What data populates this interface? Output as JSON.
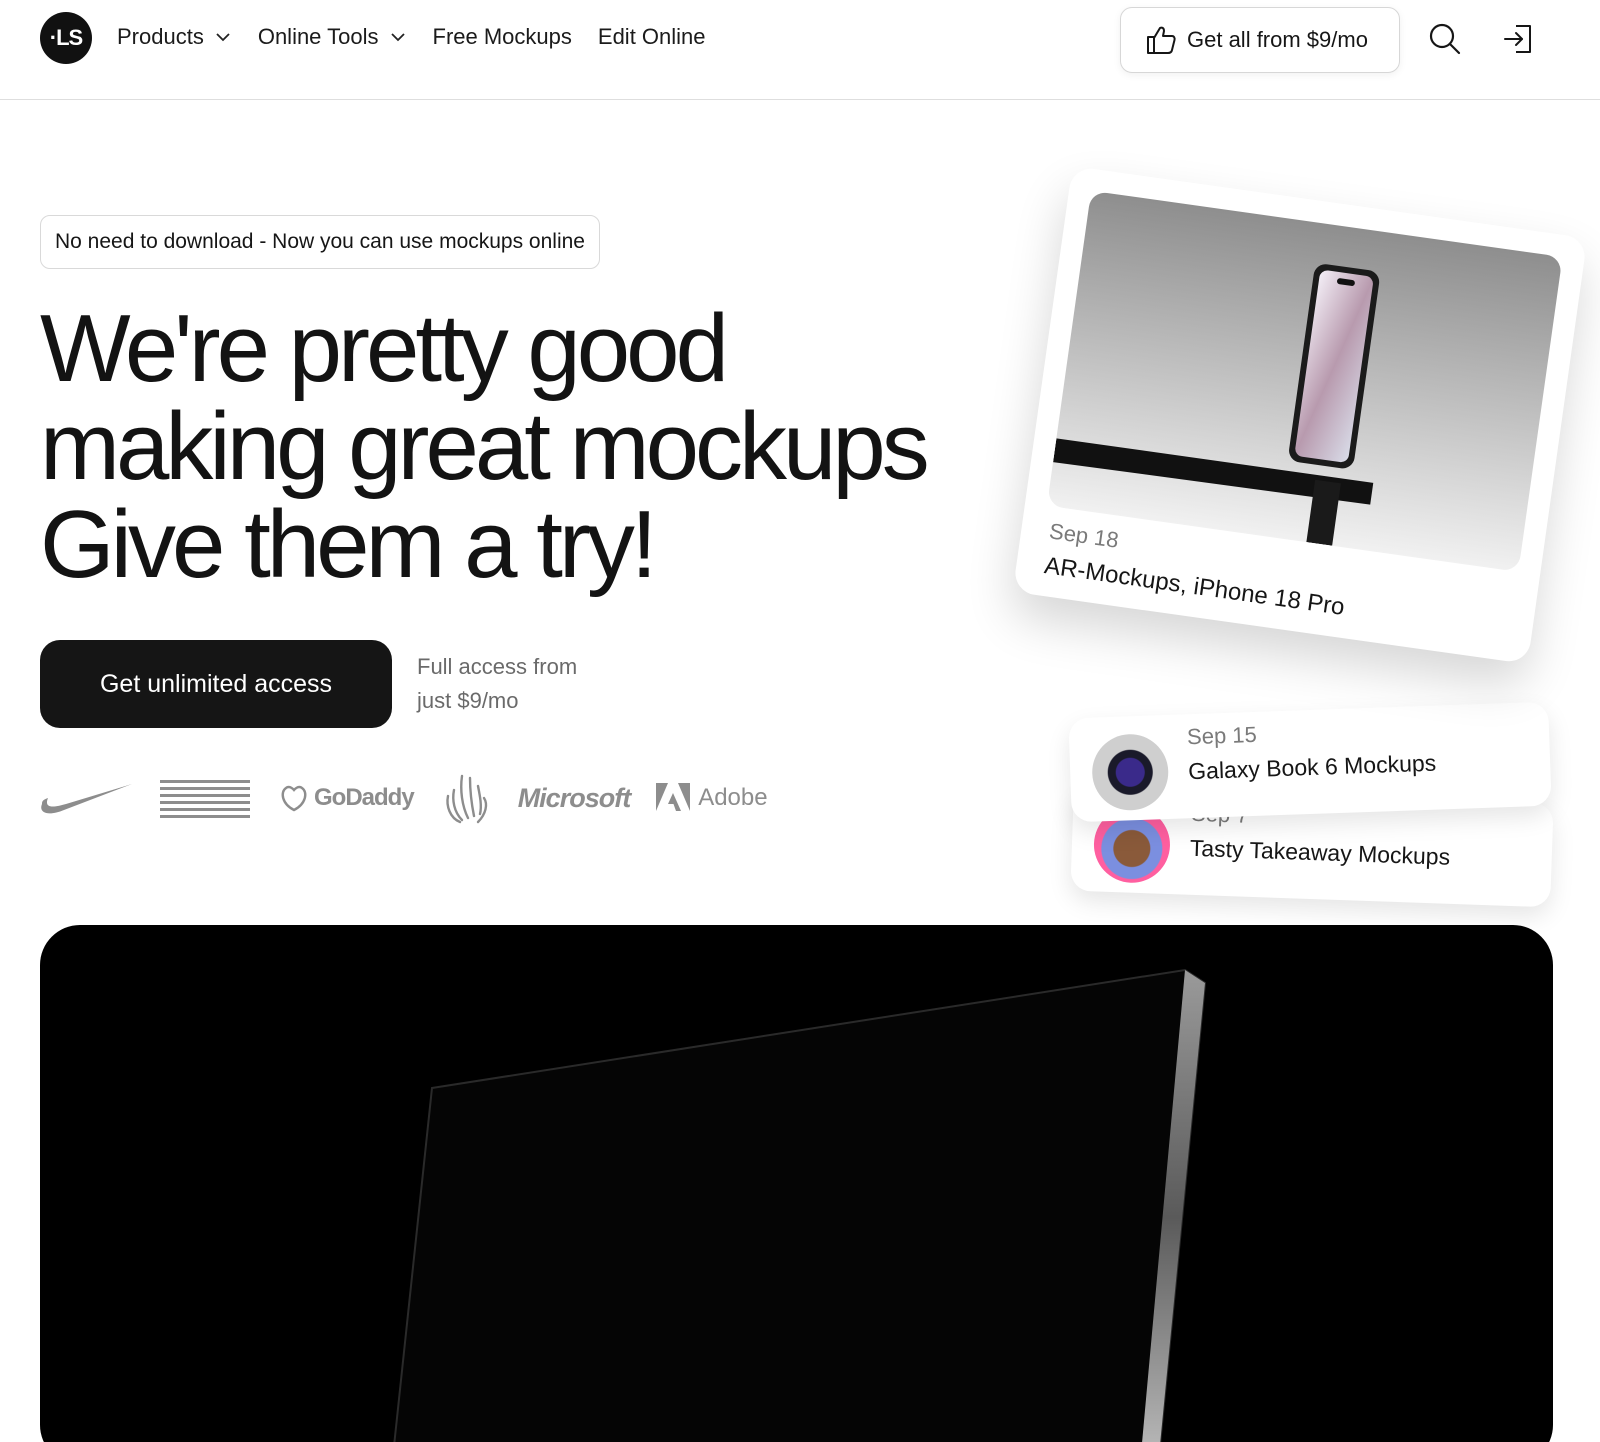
{
  "nav": {
    "logo_text": "·LS",
    "items": [
      {
        "label": "Products",
        "has_dropdown": true
      },
      {
        "label": "Online Tools",
        "has_dropdown": true
      },
      {
        "label": "Free Mockups",
        "has_dropdown": false
      },
      {
        "label": "Edit Online",
        "has_dropdown": false
      }
    ],
    "cta_label": "Get all from $9/mo",
    "search_icon": "search-icon",
    "login_icon": "login-icon"
  },
  "hero": {
    "badge": "No need to download - Now you can use mockups online",
    "headline": [
      "We're pretty good",
      "making great mockups",
      "Give them a try!"
    ],
    "button_label": "Get unlimited access",
    "note_line1": "Full access from",
    "note_line2": "just $9/mo"
  },
  "brands": [
    "nike-logo",
    "IBM",
    "GoDaddy",
    "hand-logo",
    "Microsoft",
    "Adobe"
  ],
  "feed": [
    {
      "date": "Sep 18",
      "title": "AR-Mockups, iPhone 18 Pro"
    },
    {
      "date": "Sep 15",
      "title": "Galaxy Book 6 Mockups"
    },
    {
      "date": "Sep 7",
      "title": "Tasty Takeaway Mockups"
    }
  ],
  "colors": {
    "text": "#161616",
    "primary_button": "#151515",
    "muted": "#6a6a6a",
    "video_bg": "#000000"
  }
}
